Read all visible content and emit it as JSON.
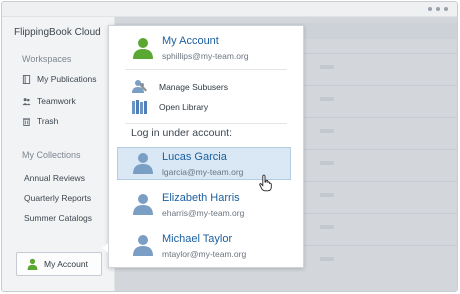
{
  "app": {
    "title": "FlippingBook Cloud"
  },
  "sidebar": {
    "workspaces_heading": "Workspaces",
    "workspace_items": [
      {
        "label": "My Publications",
        "icon": "publications-icon"
      },
      {
        "label": "Teamwork",
        "icon": "team-icon"
      },
      {
        "label": "Trash",
        "icon": "trash-icon"
      }
    ],
    "collections_heading": "My Collections",
    "collection_items": [
      {
        "label": "Annual Reviews"
      },
      {
        "label": "Quarterly Reports"
      },
      {
        "label": "Summer Catalogs"
      }
    ],
    "account_button": {
      "label": "My Account",
      "icon": "user-icon"
    }
  },
  "popup": {
    "current_account": {
      "name": "My Account",
      "email": "sphillips@my-team.org"
    },
    "menu_items": [
      {
        "label": "Manage Subusers",
        "icon": "manage-subusers-icon"
      },
      {
        "label": "Open Library",
        "icon": "library-icon"
      }
    ],
    "login_heading": "Log in under account:",
    "accounts": [
      {
        "name": "Lucas Garcia",
        "email": "lgarcia@my-team.org",
        "selected": true
      },
      {
        "name": "Elizabeth Harris",
        "email": "eharris@my-team.org",
        "selected": false
      },
      {
        "name": "Michael Taylor",
        "email": "mtaylor@my-team.org",
        "selected": false
      }
    ]
  },
  "colors": {
    "accent_green": "#5aa832",
    "link_blue": "#1c5fa0",
    "user_blue": "#7a9ec4",
    "selection": "#d9e8f4"
  }
}
